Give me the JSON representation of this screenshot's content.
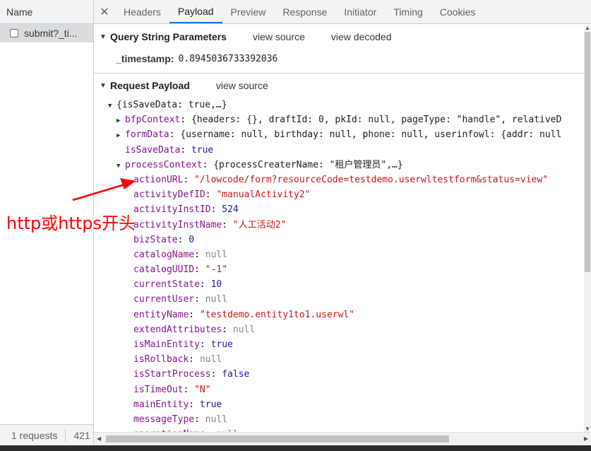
{
  "left_panel": {
    "header": "Name",
    "request_item": "submit?_ti...",
    "footer_requests": "1 requests",
    "footer_size": "421"
  },
  "tabs": {
    "close": "✕",
    "items": [
      "Headers",
      "Payload",
      "Preview",
      "Response",
      "Initiator",
      "Timing",
      "Cookies"
    ],
    "active": "Payload"
  },
  "query_section": {
    "title": "Query String Parameters",
    "link1": "view source",
    "link2": "view decoded",
    "param_key": "_timestamp:",
    "param_value": "0.8945036733392036"
  },
  "payload_section": {
    "title": "Request Payload",
    "link": "view source"
  },
  "tree": {
    "root": "{isSaveData: true,…}",
    "bfp_key": "bfpContext",
    "bfp_val": "{headers: {}, draftId: 0, pkId: null, pageType: \"handle\", relativeD",
    "form_key": "formData",
    "form_val": "{username: null, birthday: null, phone: null, userinfowl: {addr: null",
    "save_key": "isSaveData",
    "save_val": "true",
    "pc_key": "processContext",
    "pc_val": "{processCreaterName: \"租户管理员\",…}",
    "props": [
      {
        "key": "actionURL",
        "val": "\"/lowcode/form?resourceCode=testdemo.userwltestform&status=view\"",
        "type": "s"
      },
      {
        "key": "activityDefID",
        "val": "\"manualActivity2\"",
        "type": "s"
      },
      {
        "key": "activityInstID",
        "val": "524",
        "type": "n"
      },
      {
        "key": "activityInstName",
        "val": "\"人工活动2\"",
        "type": "s"
      },
      {
        "key": "bizState",
        "val": "0",
        "type": "n"
      },
      {
        "key": "catalogName",
        "val": "null",
        "type": "nul"
      },
      {
        "key": "catalogUUID",
        "val": "\"-1\"",
        "type": "s"
      },
      {
        "key": "currentState",
        "val": "10",
        "type": "n"
      },
      {
        "key": "currentUser",
        "val": "null",
        "type": "nul"
      },
      {
        "key": "entityName",
        "val": "\"testdemo.entity1to1.userwl\"",
        "type": "s"
      },
      {
        "key": "extendAttributes",
        "val": "null",
        "type": "nul"
      },
      {
        "key": "isMainEntity",
        "val": "true",
        "type": "n"
      },
      {
        "key": "isRollback",
        "val": "null",
        "type": "nul"
      },
      {
        "key": "isStartProcess",
        "val": "false",
        "type": "n"
      },
      {
        "key": "isTimeOut",
        "val": "\"N\"",
        "type": "s"
      },
      {
        "key": "mainEntity",
        "val": "true",
        "type": "n"
      },
      {
        "key": "messageType",
        "val": "null",
        "type": "nul"
      },
      {
        "key": "operationName",
        "val": "null",
        "type": "nul"
      }
    ]
  },
  "annotation": {
    "text": "http或https开头"
  },
  "colors": {
    "accent": "#1a73e8",
    "annotation": "#ff0000",
    "string": "#c41a16",
    "key": "#881391",
    "number": "#1a1aa6"
  }
}
